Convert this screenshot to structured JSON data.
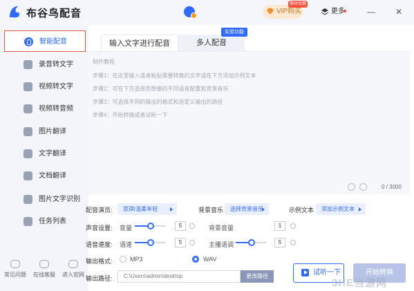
{
  "app": {
    "name": "布谷鸟配音",
    "logo_icon": "bird-logo-icon"
  },
  "titlebar": {
    "vip_label": "VIP购买",
    "vip_tag": "限时优惠",
    "more_label": "更多",
    "vip_color": "#fde9d2",
    "accent_color": "#2f6bff"
  },
  "sidebar": {
    "items": [
      {
        "label": "智能配音",
        "icon": "mic-icon",
        "active": true
      },
      {
        "label": "录音转文字",
        "icon": "chat-icon"
      },
      {
        "label": "视频转文字",
        "icon": "video-icon"
      },
      {
        "label": "视频转音频",
        "icon": "film-icon"
      },
      {
        "label": "图片翻译",
        "icon": "image-icon"
      },
      {
        "label": "文字翻译",
        "icon": "translate-icon"
      },
      {
        "label": "文档翻译",
        "icon": "document-icon"
      },
      {
        "label": "图片文字识别",
        "icon": "scan-icon"
      },
      {
        "label": "任务列表",
        "icon": "list-icon"
      }
    ],
    "bottom": [
      {
        "label": "常见问题",
        "icon": "help-icon"
      },
      {
        "label": "在线客服",
        "icon": "service-icon"
      },
      {
        "label": "进入官网",
        "icon": "web-icon"
      }
    ]
  },
  "tabs": {
    "active_label": "输入文字进行配音",
    "inactive_label": "多人配音",
    "badge": "实验功能"
  },
  "editor": {
    "title": "制作教程",
    "steps": [
      "步骤1：在这里输入或者粘贴需要转换的文字或在下方添加示例文本",
      "步骤2：可在下方选择您想要的不同语音配置和背景音乐",
      "步骤3：可选择不同的输出的格式和自定义输出的路径",
      "步骤4：开始转换或者试听一下"
    ],
    "counter": "0 / 3000"
  },
  "settings": {
    "voice_label": "配音演员:",
    "voice_value": "思琪/温柔年轻",
    "music_label": "背景音乐",
    "music_value": "选择背景音乐",
    "sample_label": "示例文本",
    "sample_value": "添加示例文本",
    "sound_label": "声音设置:",
    "volume_label": "音量",
    "volume_value": "5",
    "volume_level": 0.5,
    "bg_volume_label": "背景音量",
    "bg_volume_value": "1",
    "speed_label": "语音速度:",
    "speed_sub_label": "语速",
    "speed_value": "5",
    "speed_level": 0.5,
    "pitch_label": "主播语调",
    "pitch_value": "5",
    "pitch_level": 0.5
  },
  "output": {
    "format_label": "输出格式:",
    "formats": [
      "MP3",
      "WAV"
    ],
    "selected_format": "WAV",
    "path_label": "输出路径:",
    "path_value": "C:\\Users\\admin\\desktop",
    "change_path_label": "更改路径"
  },
  "actions": {
    "listen_label": "试听一下",
    "start_label": "开始转换"
  },
  "watermark": "3HE当游网"
}
